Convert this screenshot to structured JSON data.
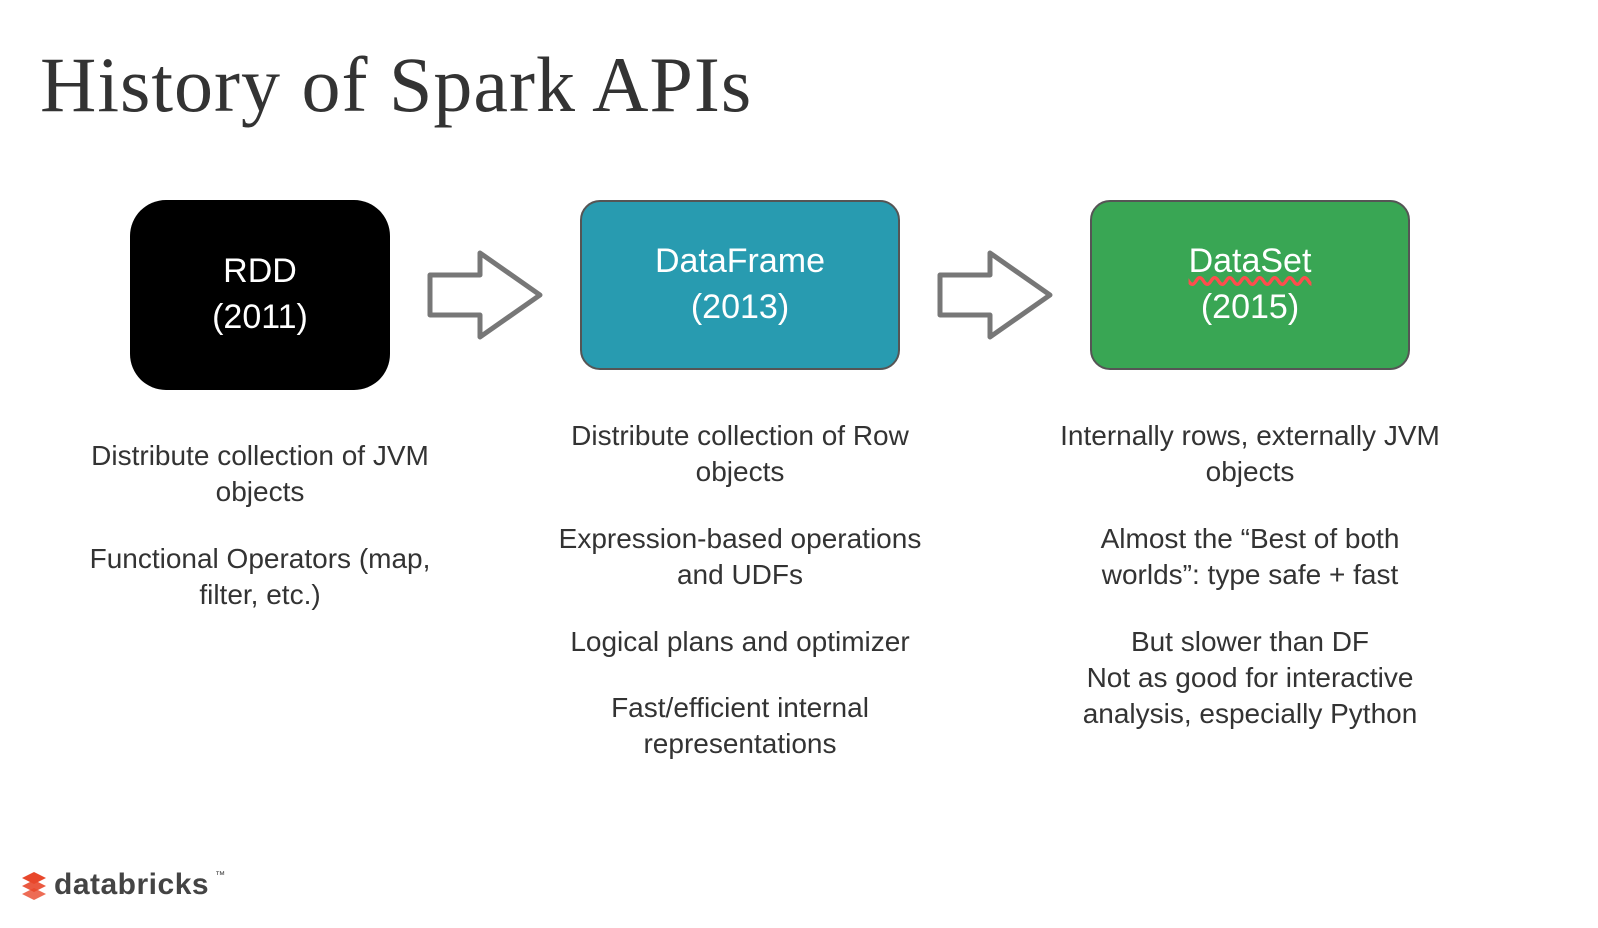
{
  "title": "History of Spark APIs",
  "boxes": {
    "rdd": {
      "name": "RDD",
      "year": "(2011)"
    },
    "df": {
      "name": "DataFrame",
      "year": "(2013)"
    },
    "ds": {
      "name": "DataSet",
      "year": "(2015)"
    }
  },
  "desc": {
    "rdd": [
      "Distribute collection of JVM objects",
      "Functional Operators (map, filter, etc.)"
    ],
    "df": [
      "Distribute collection of Row objects",
      "Expression-based operations and UDFs",
      "Logical plans and optimizer",
      "Fast/efficient internal representations"
    ],
    "ds": [
      "Internally rows, externally JVM objects",
      "Almost the “Best of both worlds”: type safe + fast",
      "But slower than DF\nNot as good for interactive analysis, especially Python"
    ]
  },
  "brand": "databricks"
}
